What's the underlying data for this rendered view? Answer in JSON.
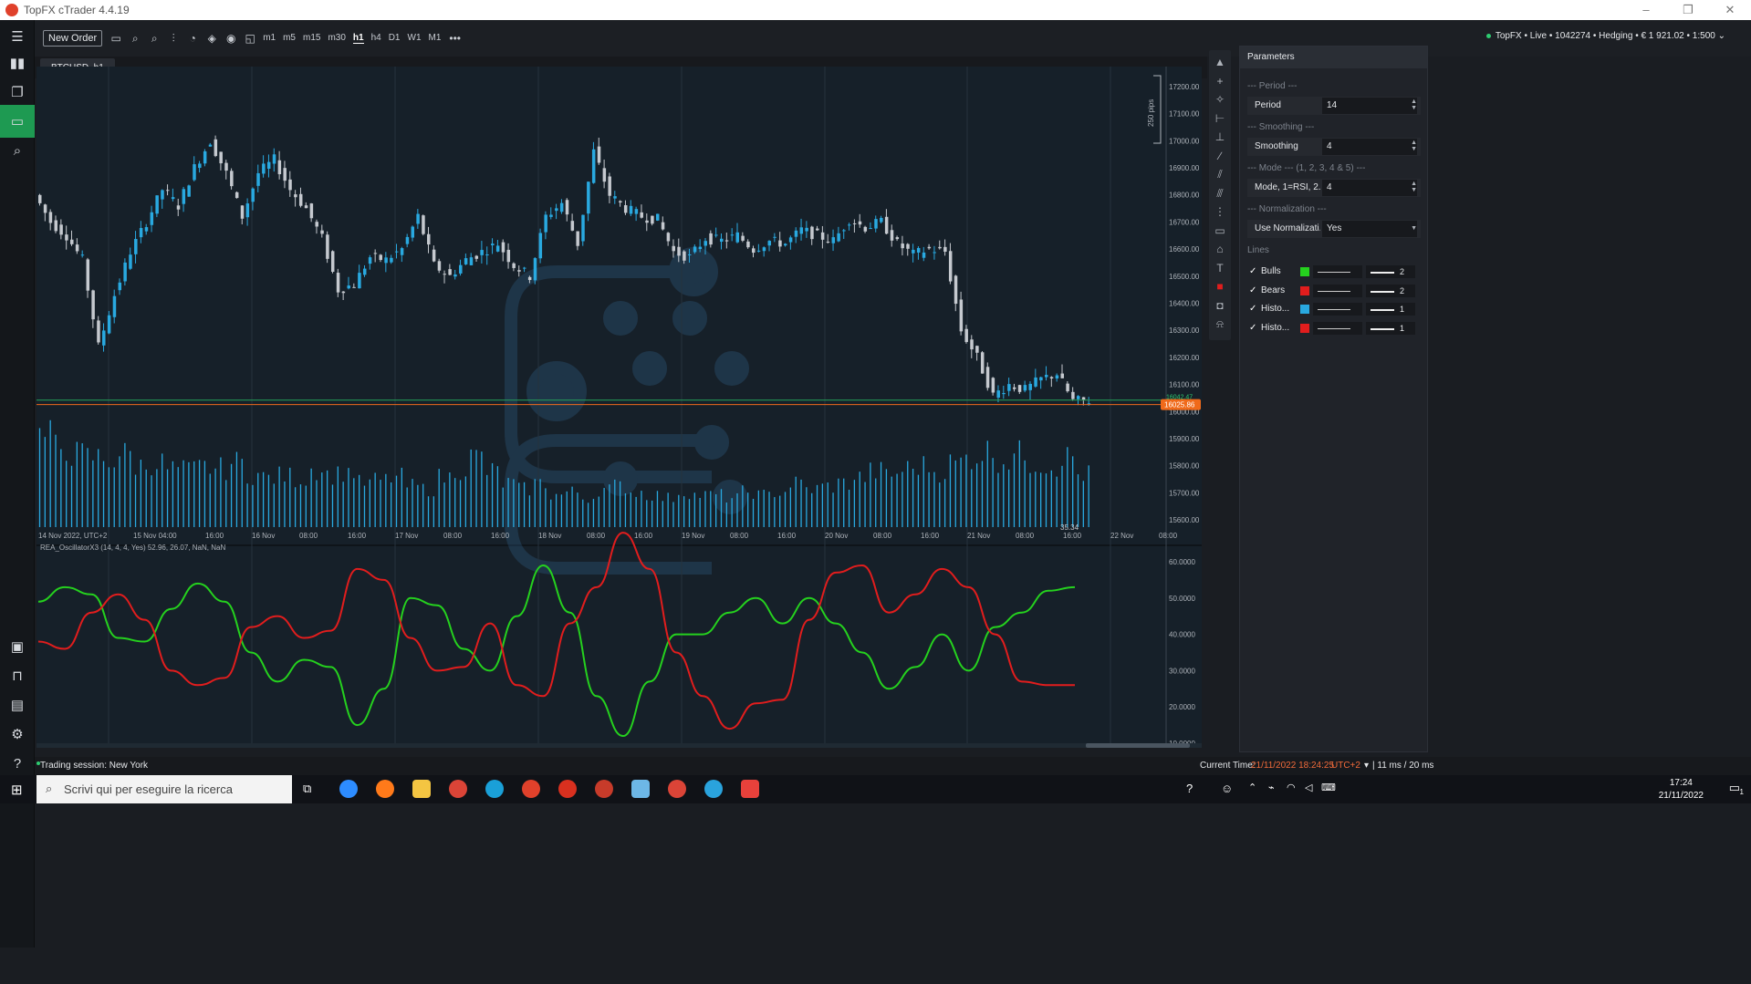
{
  "window": {
    "title": "TopFX cTrader 4.4.19",
    "minimize": "–",
    "maximize": "❐",
    "close": "✕"
  },
  "left_nav": [
    {
      "name": "nav-trade-icon",
      "glyph": "▮▮"
    },
    {
      "name": "nav-copy-icon",
      "glyph": "❐"
    },
    {
      "name": "nav-automate-icon",
      "glyph": "▭",
      "active": true
    },
    {
      "name": "nav-analyze-icon",
      "glyph": "⌕"
    },
    {
      "name": "nav-portfolio-icon",
      "glyph": "▣"
    },
    {
      "name": "nav-store-icon",
      "glyph": "⊓"
    },
    {
      "name": "nav-wallet-icon",
      "glyph": "▤"
    },
    {
      "name": "nav-settings-icon",
      "glyph": "⚙"
    },
    {
      "name": "nav-help-icon",
      "glyph": "?"
    }
  ],
  "toolbar": {
    "menu_glyph": "☰",
    "new_order": "New Order",
    "icons": [
      "▭",
      "⌕",
      "⌕",
      "⫶",
      "◔",
      "◈",
      "◉",
      "◱"
    ],
    "timeframes": [
      {
        "label": "m1"
      },
      {
        "label": "m5"
      },
      {
        "label": "m15"
      },
      {
        "label": "m30"
      },
      {
        "label": "h1",
        "active": true
      },
      {
        "label": "h4"
      },
      {
        "label": "D1"
      },
      {
        "label": "W1"
      },
      {
        "label": "M1"
      }
    ],
    "more": "•••",
    "account": "TopFX • Live • 1042274 • Hedging • € 1 921.02 • 1:500",
    "account_chevron": "⌄"
  },
  "chart_tab": "BTCUSD, h1",
  "chart_data": [
    {
      "type": "candlestick",
      "symbol": "BTCUSD, h1",
      "y_ticks": [
        "17200.00",
        "17100.00",
        "17000.00",
        "16900.00",
        "16800.00",
        "16700.00",
        "16600.00",
        "16500.00",
        "16400.00",
        "16300.00",
        "16200.00",
        "16100.00",
        "16000.00",
        "15900.00",
        "15800.00",
        "15700.00",
        "15600.00"
      ],
      "ylim": [
        15550,
        17240
      ],
      "x_ticks": [
        "14 Nov 2022, UTC+2",
        "15 Nov 04:00",
        "16:00",
        "16 Nov",
        "08:00",
        "16:00",
        "17 Nov",
        "08:00",
        "16:00",
        "18 Nov",
        "08:00",
        "16:00",
        "19 Nov",
        "08:00",
        "16:00",
        "20 Nov",
        "08:00",
        "16:00",
        "21 Nov",
        "08:00",
        "16:00",
        "22 Nov",
        "08:00"
      ],
      "close_path": [
        16800,
        16700,
        16650,
        16560,
        16240,
        16430,
        16590,
        16700,
        16820,
        16760,
        16900,
        17000,
        16880,
        16720,
        16880,
        16930,
        16820,
        16750,
        16640,
        16450,
        16470,
        16570,
        16560,
        16600,
        16720,
        16540,
        16500,
        16560,
        16590,
        16620,
        16540,
        16500,
        16720,
        16770,
        16620,
        16960,
        16800,
        16750,
        16720,
        16710,
        16590,
        16570,
        16640,
        16630,
        16650,
        16600,
        16630,
        16620,
        16670,
        16650,
        16630,
        16710,
        16680,
        16700,
        16620,
        16580,
        16600,
        16590,
        16300,
        16200,
        16060,
        16100,
        16080,
        16120,
        16140,
        16040
      ],
      "current_price": "16025.86",
      "current_line_label": "16042.47",
      "volume_label": "35.34",
      "volume": [
        62,
        55,
        50,
        48,
        46,
        50,
        42,
        44,
        40,
        39,
        41,
        40,
        44,
        36,
        34,
        35,
        33,
        40,
        36,
        38,
        30,
        32,
        34,
        28,
        26,
        34,
        40,
        48,
        38,
        30,
        26,
        30,
        22,
        24,
        20,
        26,
        28,
        24,
        22,
        20,
        24,
        22,
        22,
        20,
        24,
        22,
        24,
        30,
        26,
        28,
        30,
        34,
        38,
        36,
        40,
        42,
        38,
        44,
        48,
        52,
        46,
        50,
        44,
        42,
        48,
        36
      ],
      "pips_label": "250 pips"
    },
    {
      "type": "line",
      "title": "REA_OscillatorX3 (14, 4, 4, Yes) 52.96, 26.07, NaN, NaN",
      "y_ticks": [
        "60.0000",
        "50.0000",
        "40.0000",
        "30.0000",
        "20.0000",
        "10.0000"
      ],
      "ylim": [
        10,
        62
      ],
      "series": [
        {
          "name": "Bulls",
          "color": "#25d11e",
          "values": [
            49,
            53,
            51,
            39,
            38,
            47,
            54,
            49,
            35,
            27,
            33,
            31,
            15,
            25,
            50,
            48,
            36,
            30,
            45,
            59,
            46,
            23,
            12,
            27,
            40,
            40,
            46,
            50,
            43,
            50,
            43,
            35,
            25,
            31,
            40,
            30,
            42,
            46,
            52,
            53
          ]
        },
        {
          "name": "Bears",
          "color": "#e11d1d",
          "values": [
            38,
            36,
            46,
            51,
            44,
            30,
            26,
            28,
            42,
            45,
            39,
            41,
            58,
            55,
            39,
            30,
            31,
            43,
            26,
            23,
            43,
            53,
            68,
            58,
            35,
            23,
            14,
            21,
            22,
            44,
            57,
            59,
            46,
            51,
            58,
            53,
            40,
            27,
            26,
            26
          ]
        }
      ]
    }
  ],
  "drawing_tools": [
    "▲",
    "+",
    "✧",
    "⊢",
    "⊥",
    "∕",
    "⫽",
    "⫻",
    "⋮",
    "▭",
    "⌂",
    "T",
    "■",
    "◘",
    "⍾"
  ],
  "params": {
    "title": "Parameters",
    "section_period": "--- Period ---",
    "period_label": "Period",
    "period_value": "14",
    "section_smoothing": "--- Smoothing ---",
    "smoothing_label": "Smoothing",
    "smoothing_value": "4",
    "section_mode": "--- Mode --- (1, 2, 3, 4 & 5) ---",
    "mode_label": "Mode, 1=RSI, 2...",
    "mode_value": "4",
    "section_norm": "--- Normalization ---",
    "norm_label": "Use Normalizati...",
    "norm_value": "Yes",
    "section_lines": "Lines",
    "lines": [
      {
        "name": "Bulls",
        "color": "#25d11e",
        "width": "2"
      },
      {
        "name": "Bears",
        "color": "#e11d1d",
        "width": "2"
      },
      {
        "name": "Histo...",
        "color": "#29a9e0",
        "width": "1"
      },
      {
        "name": "Histo...",
        "color": "#e11d1d",
        "width": "1"
      }
    ]
  },
  "status": {
    "session": "Trading session: New York",
    "time_label": "Current Time:",
    "time_value": "21/11/2022 18:24:25",
    "tz": "UTC+2",
    "latency": "| 11 ms / 20 ms"
  },
  "taskbar": {
    "search_placeholder": "Scrivi qui per eseguire la ricerca",
    "time": "17:24",
    "date": "21/11/2022",
    "notification_count": "1"
  }
}
